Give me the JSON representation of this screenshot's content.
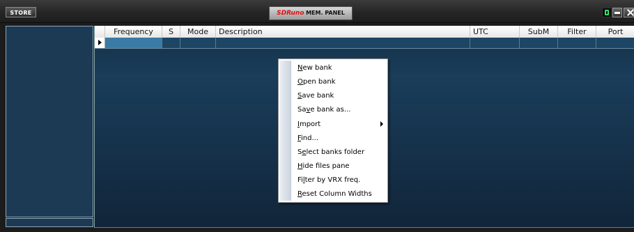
{
  "titlebar": {
    "store_label": "STORE",
    "logo_brand": "SDRuno",
    "logo_sub": "MEM. PANEL"
  },
  "grid": {
    "columns": [
      "Frequency",
      "S",
      "Mode",
      "Description",
      "UTC",
      "SubM",
      "Filter",
      "Port"
    ]
  },
  "context_menu": {
    "items": [
      {
        "pre": "",
        "u": "N",
        "post": "ew bank"
      },
      {
        "pre": "",
        "u": "O",
        "post": "pen bank"
      },
      {
        "pre": "",
        "u": "S",
        "post": "ave bank"
      },
      {
        "pre": "Sa",
        "u": "v",
        "post": "e bank as..."
      },
      {
        "pre": "",
        "u": "I",
        "post": "mport"
      },
      {
        "pre": "",
        "u": "F",
        "post": "ind..."
      },
      {
        "pre": "S",
        "u": "e",
        "post": "lect banks folder"
      },
      {
        "pre": "",
        "u": "H",
        "post": "ide files pane"
      },
      {
        "pre": "Fi",
        "u": "l",
        "post": "ter by VRX freq."
      },
      {
        "pre": "",
        "u": "R",
        "post": "eset Column Widths"
      }
    ]
  },
  "icons": [
    "digit-display-icon",
    "minimize-icon",
    "close-icon",
    "current-row-arrow-icon",
    "submenu-arrow-icon"
  ],
  "colors": {
    "brand_red": "#dd1111",
    "grid_background": "#1a3d5a",
    "selected_cell": "#3a7aa6",
    "pane_background": "#1c3a53"
  }
}
